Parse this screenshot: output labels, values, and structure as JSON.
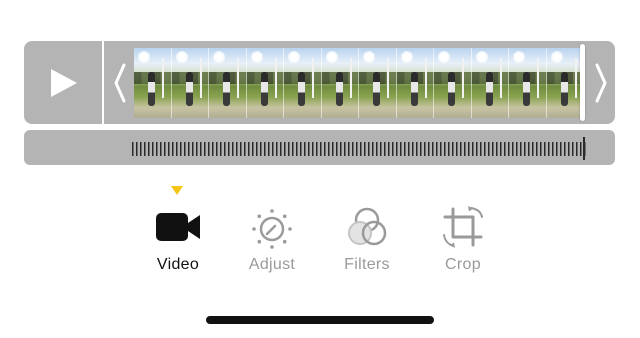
{
  "trim": {
    "play_icon": "play-icon",
    "left_handle_icon": "chevron-left-icon",
    "right_handle_icon": "chevron-right-icon",
    "frame_count": 12,
    "frame_icon": "golf-swing-thumbnail"
  },
  "scrubber": {
    "tick_icon": "waveform-ticks"
  },
  "tabs": [
    {
      "id": "video",
      "label": "Video",
      "icon": "video-camera-icon",
      "active": true
    },
    {
      "id": "adjust",
      "label": "Adjust",
      "icon": "adjust-dial-icon",
      "active": false
    },
    {
      "id": "filters",
      "label": "Filters",
      "icon": "filters-circles-icon",
      "active": false
    },
    {
      "id": "crop",
      "label": "Crop",
      "icon": "crop-rotate-icon",
      "active": false
    }
  ],
  "colors": {
    "active_indicator": "#F5C518",
    "active_label": "#111111",
    "inactive": "#9A9A9A",
    "bar_background": "#B4B4B4"
  }
}
